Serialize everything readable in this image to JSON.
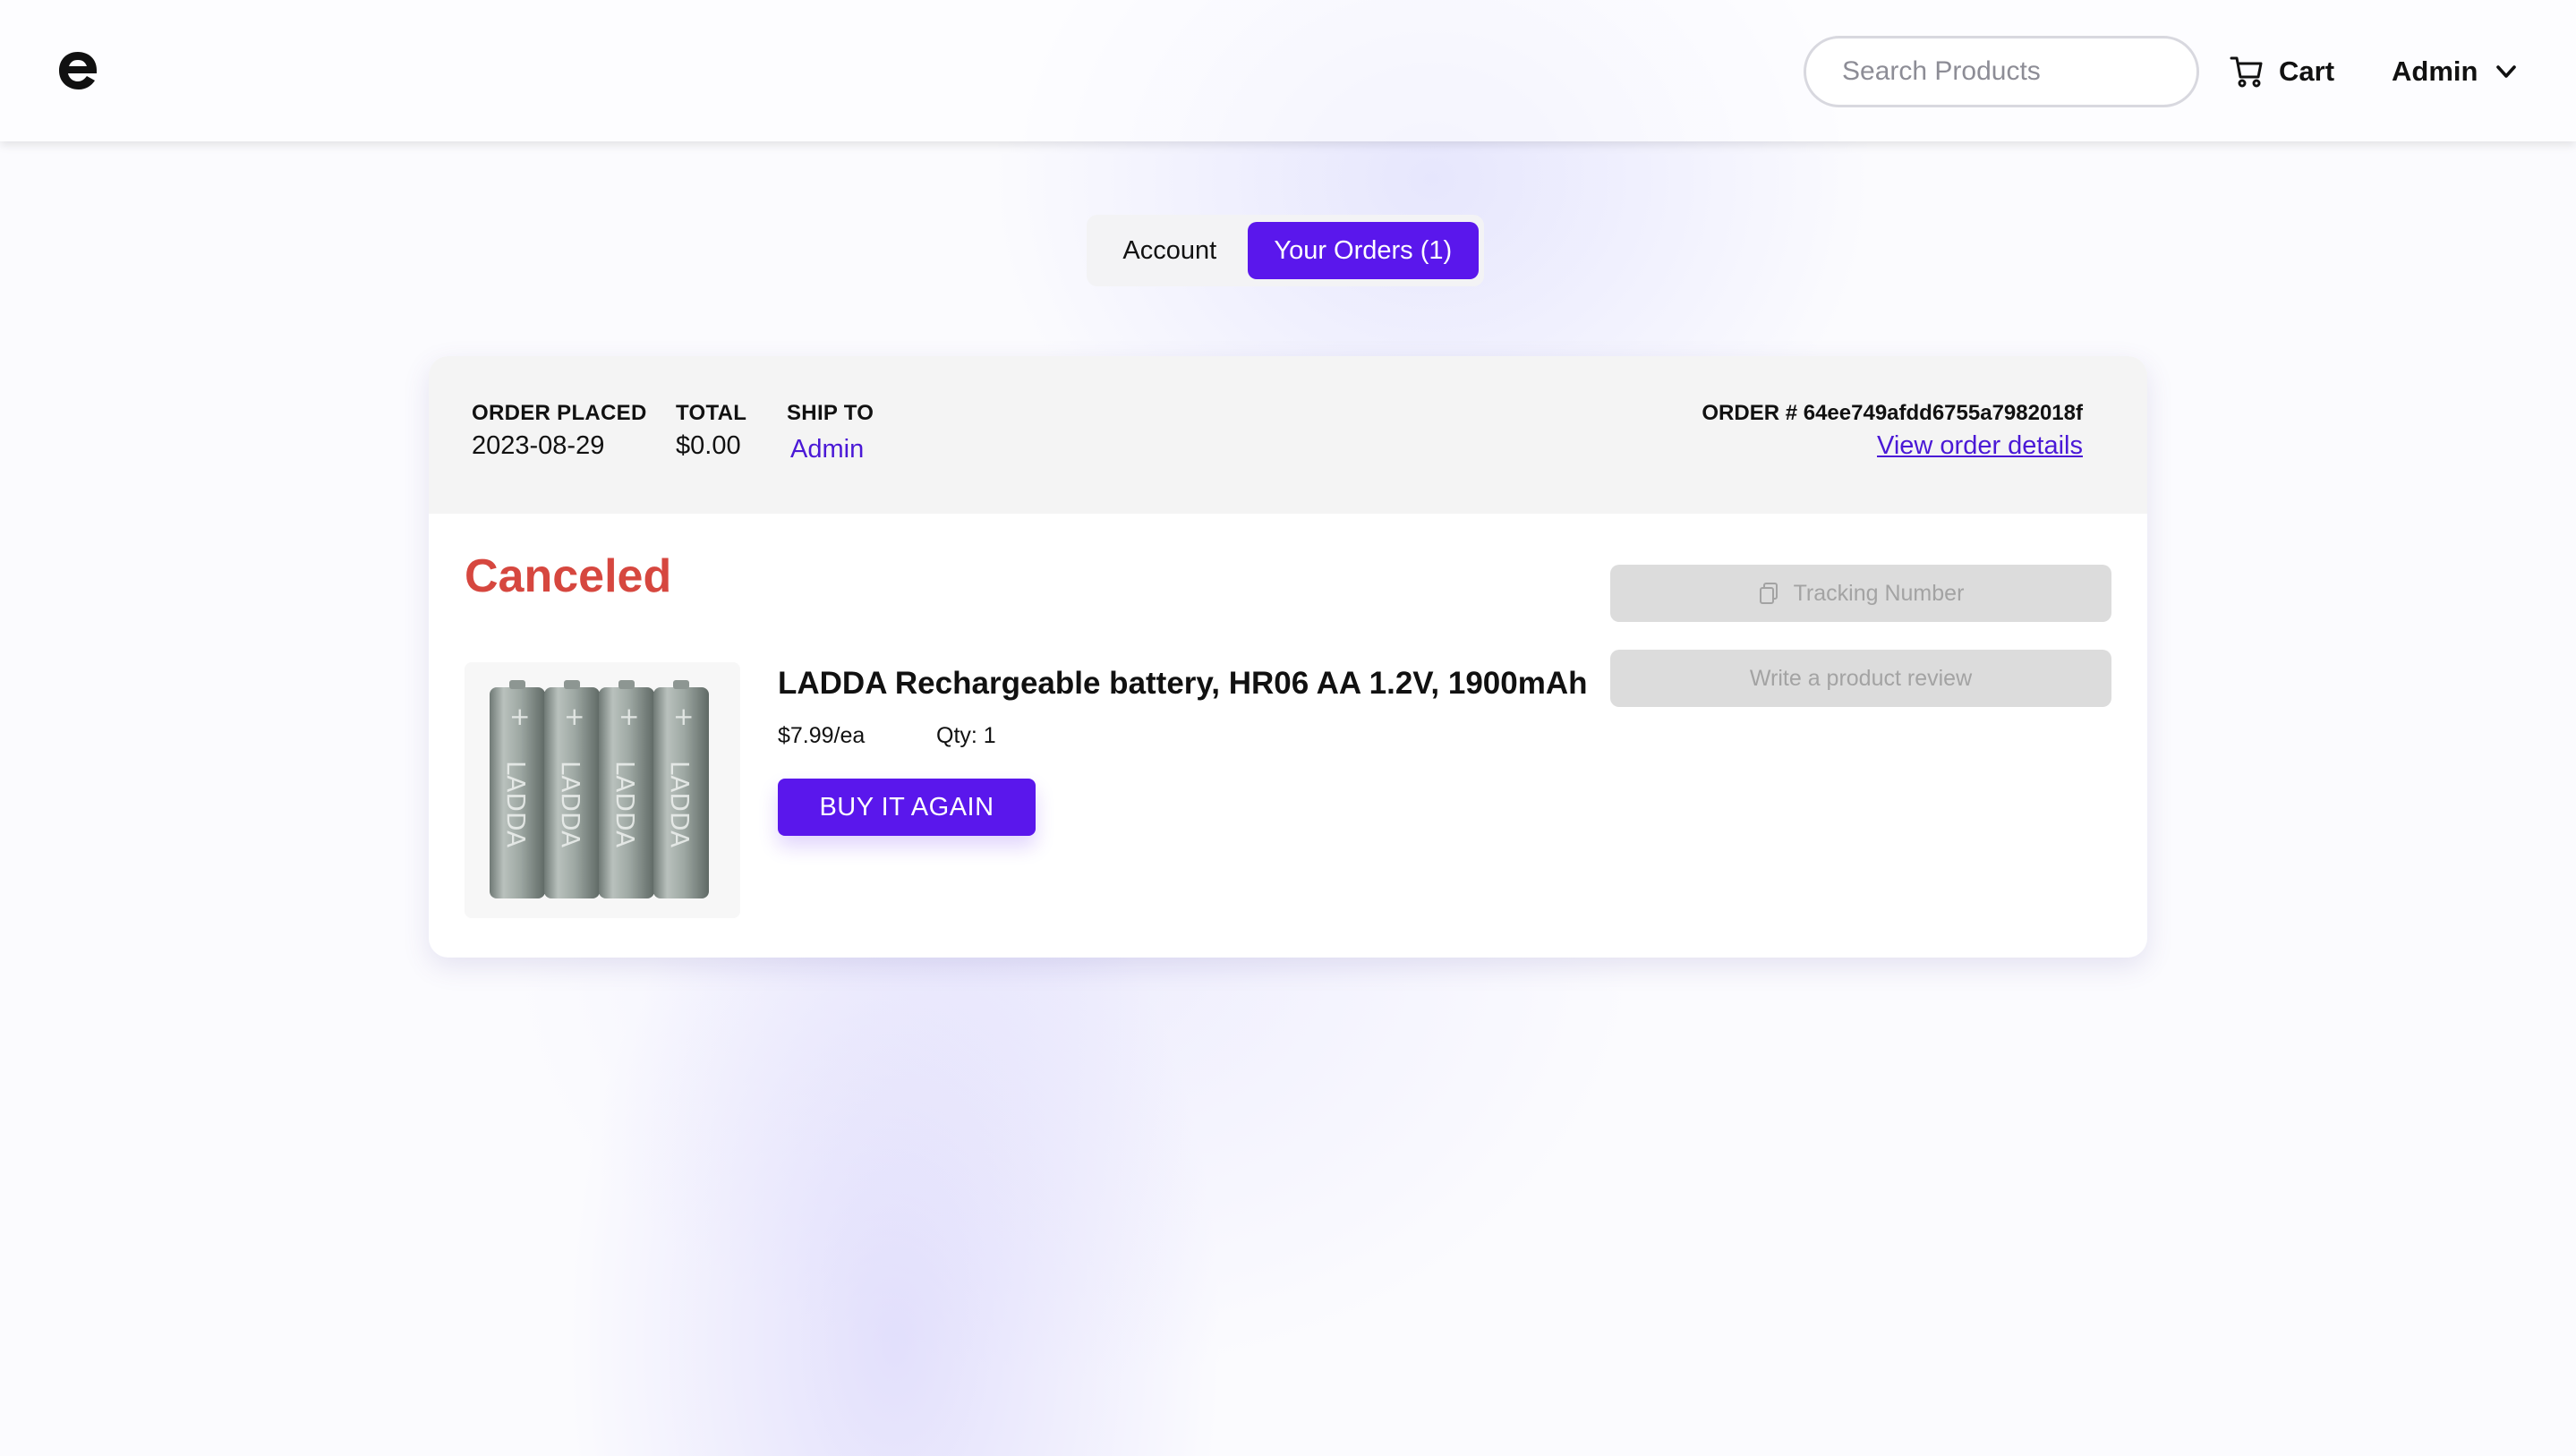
{
  "header": {
    "logo_icon": "brand-e-logo",
    "search": {
      "placeholder": "Search Products",
      "value": "",
      "icon": "search-icon"
    },
    "cart": {
      "label": "Cart",
      "icon": "cart-icon"
    },
    "user": {
      "label": "Admin",
      "icon": "chevron-down-icon"
    }
  },
  "tabs": [
    {
      "label": "Account",
      "active": false
    },
    {
      "label": "Your Orders (1)",
      "active": true
    }
  ],
  "order": {
    "placed_label": "ORDER PLACED",
    "placed_value": "2023-08-29",
    "total_label": "TOTAL",
    "total_value": "$0.00",
    "ship_label": "SHIP TO",
    "ship_value": "Admin",
    "order_number": "ORDER # 64ee749afdd6755a7982018f",
    "view_details": "View order details",
    "status": "Canceled",
    "status_color": "#d6473f",
    "item": {
      "title": "LADDA Rechargeable battery, HR06 AA 1.2V, 1900mAh",
      "price": "$7.99/ea",
      "qty": "Qty: 1",
      "buy_again": "BUY IT AGAIN",
      "image_text": "LADDA"
    },
    "tracking_button": {
      "label": "Tracking Number",
      "icon": "copy-icon"
    },
    "review_button": {
      "label": "Write a product review"
    }
  },
  "colors": {
    "accent": "#5a17ec",
    "link": "#4a18d6",
    "disabled_bg": "#dcdcdc",
    "disabled_text": "#a3a3a3"
  }
}
